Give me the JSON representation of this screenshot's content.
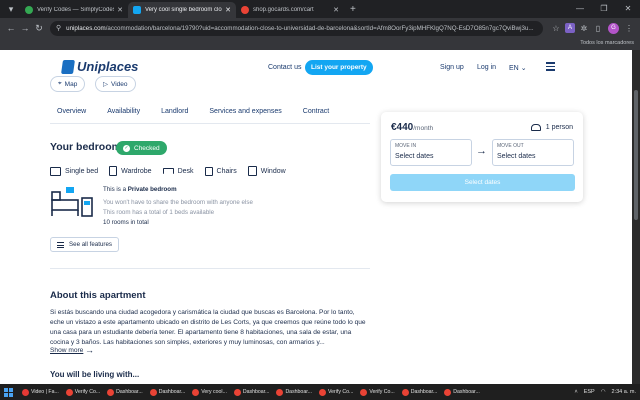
{
  "browser": {
    "tabs": [
      {
        "title": "Verify Codes — SimplyCodes",
        "active": false,
        "favicon_color": "#34a853"
      },
      {
        "title": "Very cool single bedroom close",
        "active": true,
        "favicon_color": "#13a6f2"
      },
      {
        "title": "shop.gocards.com/cart",
        "active": false,
        "favicon_color": "#ea4335"
      }
    ],
    "url_domain": "uniplaces.com",
    "url_path": "/accommodation/barcelona/19790?uid=accommodation-close-to-universidad-de-barcelona&sortId=Afm8OorFy3ipMHFKlgQ7NQ-EsD7O85n7gc7QviBwj3u...",
    "bookmarks_label": "Todos los marcadores",
    "profile_initial": "G",
    "ext_initial": "A"
  },
  "site": {
    "logo_text": "Uniplaces",
    "contact": "Contact us",
    "list_property": "List your property",
    "signup": "Sign up",
    "login": "Log in",
    "lang": "EN",
    "chips": [
      "Map",
      "Video"
    ],
    "nav_tabs": [
      "Overview",
      "Availability",
      "Landlord",
      "Services and expenses",
      "Contract"
    ]
  },
  "bedroom": {
    "heading": "Your bedroom",
    "badge": "Checked",
    "amenities": [
      "Single bed",
      "Wardrobe",
      "Desk",
      "Chairs",
      "Window"
    ],
    "type_prefix": "This is a ",
    "type_strong": "Private bedroom",
    "line1": "You won't have to share the bedroom with anyone else",
    "line2": "This room has a total of 1 beds available",
    "line3": "10 rooms in total",
    "see_all": "See all features"
  },
  "about": {
    "heading": "About this apartment",
    "text": "Si estás buscando una ciudad acogedora y carismática la ciudad que buscas es Barcelona. Por lo tanto, eche un vistazo a este apartamento ubicado en distrito de Les Corts, ya que creemos que reúne todo lo que una casa para un estudiante debería tener. El apartamento tiene 8 habitaciones, una sala de estar, una cocina y 3 baños. Las habitaciones son simples, exteriores y muy luminosas, con armarios y...",
    "show_more": "Show more",
    "living_heading": "You will be living with..."
  },
  "booking": {
    "price": "€440",
    "per": "/month",
    "persons": "1 person",
    "move_in_label": "MOVE IN",
    "move_in_value": "Select dates",
    "move_out_label": "MOVE OUT",
    "move_out_value": "Select dates",
    "button": "Select dates"
  },
  "taskbar": {
    "items": [
      {
        "label": "Video | Fa...",
        "color": "#e53935"
      },
      {
        "label": "Verify Co...",
        "color": "#ea4335"
      },
      {
        "label": "Dashboar...",
        "color": "#ea4335"
      },
      {
        "label": "Dashboar...",
        "color": "#ea4335"
      },
      {
        "label": "Very cool...",
        "color": "#ea4335"
      },
      {
        "label": "Dashboar...",
        "color": "#ea4335"
      },
      {
        "label": "Dashboar...",
        "color": "#ea4335"
      },
      {
        "label": "Verify Co...",
        "color": "#ea4335"
      },
      {
        "label": "Verify Co...",
        "color": "#ea4335"
      },
      {
        "label": "Dashboar...",
        "color": "#ea4335"
      },
      {
        "label": "Dashboar...",
        "color": "#ea4335"
      }
    ],
    "lang": "ESP",
    "time": "2:34 a. m."
  }
}
